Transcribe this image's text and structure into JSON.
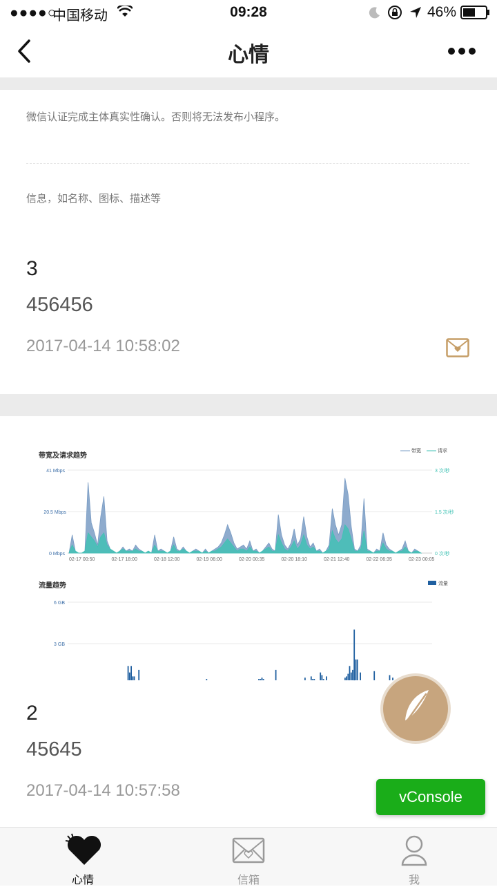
{
  "status_bar": {
    "signal": "●●●●○",
    "carrier": "中国移动",
    "time": "09:28",
    "battery": "46%"
  },
  "nav": {
    "title": "心情"
  },
  "tips": {
    "line1": "微信认证完成主体真实性确认。否则将无法发布小程序。",
    "line2": "信息，如名称、图标、描述等"
  },
  "posts": [
    {
      "number": "3",
      "content": "456456",
      "timestamp": "2017-04-14 10:58:02"
    },
    {
      "number": "2",
      "content": "45645",
      "timestamp": "2017-04-14 10:57:58"
    }
  ],
  "chart_data": [
    {
      "type": "area",
      "title": "带宽及请求趋势",
      "legend": [
        "带宽",
        "请求"
      ],
      "legend_position": "top-right",
      "y_left_ticks": [
        "41 Mbps",
        "20.5 Mbps",
        "0 Mbps"
      ],
      "y_right_ticks": [
        "3 次/秒",
        "1.5 次/秒",
        "0 次/秒"
      ],
      "x_ticks": [
        "02-17 00:50",
        "02-17 18:00",
        "02-18 12:00",
        "02-19 06:00",
        "02-20 00:35",
        "02-20 18:10",
        "02-21 12:40",
        "02-22 06:35",
        "02-23 00:05"
      ],
      "ylim": [
        0,
        41
      ],
      "grid": true,
      "series": [
        {
          "name": "带宽",
          "color": "#7a9cc4",
          "values": [
            0,
            9,
            1,
            0,
            0,
            1,
            35,
            15,
            10,
            4,
            18,
            28,
            6,
            2,
            1,
            0,
            1,
            3,
            1,
            2,
            1,
            4,
            2,
            1,
            0,
            1,
            0,
            9,
            1,
            2,
            1,
            0,
            1,
            8,
            2,
            1,
            3,
            1,
            0,
            1,
            2,
            1,
            0,
            2,
            0,
            1,
            2,
            3,
            5,
            9,
            14,
            10,
            5,
            2,
            3,
            4,
            2,
            6,
            1,
            2,
            0,
            1,
            3,
            5,
            2,
            1,
            19,
            9,
            4,
            2,
            5,
            12,
            4,
            7,
            18,
            8,
            3,
            5,
            1,
            2,
            0,
            1,
            4,
            22,
            14,
            9,
            14,
            37,
            29,
            13,
            2,
            1,
            4,
            27,
            2,
            1,
            0,
            2,
            1,
            10,
            4,
            2,
            1,
            0,
            1,
            2,
            6,
            1,
            0,
            2,
            1,
            0
          ]
        },
        {
          "name": "请求",
          "color": "#3fc2b4",
          "values": [
            0,
            4,
            1,
            0,
            0,
            1,
            10,
            8,
            6,
            3,
            8,
            10,
            4,
            2,
            1,
            0,
            1,
            2,
            1,
            1,
            1,
            2,
            1,
            1,
            0,
            1,
            0,
            4,
            1,
            1,
            1,
            0,
            1,
            4,
            1,
            1,
            2,
            1,
            0,
            1,
            1,
            1,
            0,
            1,
            0,
            1,
            1,
            2,
            3,
            5,
            7,
            5,
            3,
            1,
            2,
            2,
            1,
            3,
            1,
            1,
            0,
            1,
            2,
            3,
            1,
            1,
            9,
            5,
            2,
            1,
            3,
            6,
            2,
            4,
            9,
            4,
            2,
            3,
            1,
            1,
            0,
            1,
            2,
            11,
            7,
            5,
            7,
            14,
            12,
            7,
            1,
            1,
            2,
            11,
            1,
            1,
            0,
            1,
            1,
            5,
            2,
            1,
            1,
            0,
            1,
            1,
            3,
            1,
            0,
            1,
            1,
            0
          ]
        }
      ]
    },
    {
      "type": "bar",
      "title": "流量趋势",
      "legend": [
        "流量"
      ],
      "legend_position": "top-right",
      "y_ticks": [
        "6 GB",
        "3 GB"
      ],
      "ylim": [
        0,
        6
      ],
      "grid": true,
      "series": [
        {
          "name": "流量",
          "color": "#1f5fa0",
          "values": [
            0,
            0,
            0,
            0,
            0,
            0,
            0,
            0,
            0,
            0,
            0,
            0,
            0,
            0,
            0,
            0,
            0,
            0,
            0,
            0,
            0,
            0,
            0,
            0,
            0,
            0,
            0,
            0,
            0,
            0,
            0,
            0,
            0,
            0,
            0,
            0,
            0,
            0,
            1.1,
            0.6,
            1.1,
            0.3,
            0.3,
            0,
            0,
            0.8,
            0,
            0,
            0,
            0,
            0,
            0,
            0,
            0,
            0,
            0,
            0,
            0,
            0,
            0,
            0,
            0,
            0,
            0,
            0,
            0,
            0,
            0,
            0,
            0,
            0,
            0,
            0,
            0,
            0,
            0,
            0,
            0,
            0,
            0,
            0,
            0,
            0,
            0,
            0,
            0,
            0,
            0,
            0,
            0.1,
            0,
            0,
            0,
            0,
            0,
            0,
            0,
            0,
            0,
            0,
            0,
            0,
            0,
            0,
            0,
            0,
            0,
            0,
            0,
            0,
            0,
            0,
            0,
            0,
            0,
            0,
            0,
            0,
            0,
            0,
            0,
            0,
            0,
            0.1,
            0.1,
            0.2,
            0.1,
            0,
            0,
            0,
            0,
            0,
            0,
            0,
            0.8,
            0,
            0,
            0,
            0,
            0,
            0,
            0,
            0,
            0,
            0,
            0,
            0,
            0,
            0,
            0,
            0,
            0,
            0,
            0.2,
            0,
            0,
            0,
            0.3,
            0.1,
            0.1,
            0,
            0,
            0,
            0.6,
            0.4,
            0.1,
            0,
            0.3,
            0,
            0,
            0,
            0,
            0,
            0,
            0,
            0,
            0,
            0,
            0,
            0.2,
            0.3,
            0.5,
            1.1,
            0.6,
            0.8,
            3.9,
            1.6,
            1.6,
            0,
            0.6,
            0,
            0,
            0,
            0,
            0,
            0,
            0,
            0,
            0.7,
            0,
            0,
            0,
            0,
            0,
            0,
            0,
            0,
            0,
            0.4,
            0,
            0.2,
            0,
            0,
            0,
            0,
            0,
            0,
            0,
            0,
            0.1,
            0,
            0,
            0,
            0,
            0,
            0,
            0,
            0,
            0,
            0,
            0,
            0,
            0,
            0,
            0,
            0
          ]
        }
      ]
    }
  ],
  "floating": {
    "write_icon": "feather-icon",
    "vconsole_label": "vConsole"
  },
  "tabbar": {
    "tabs": [
      {
        "label": "心情",
        "icon": "heart-icon",
        "active": true,
        "color": "#111111"
      },
      {
        "label": "信箱",
        "icon": "mail-icon",
        "active": false,
        "color": "#999999"
      },
      {
        "label": "我",
        "icon": "user-icon",
        "active": false,
        "color": "#999999"
      }
    ]
  }
}
